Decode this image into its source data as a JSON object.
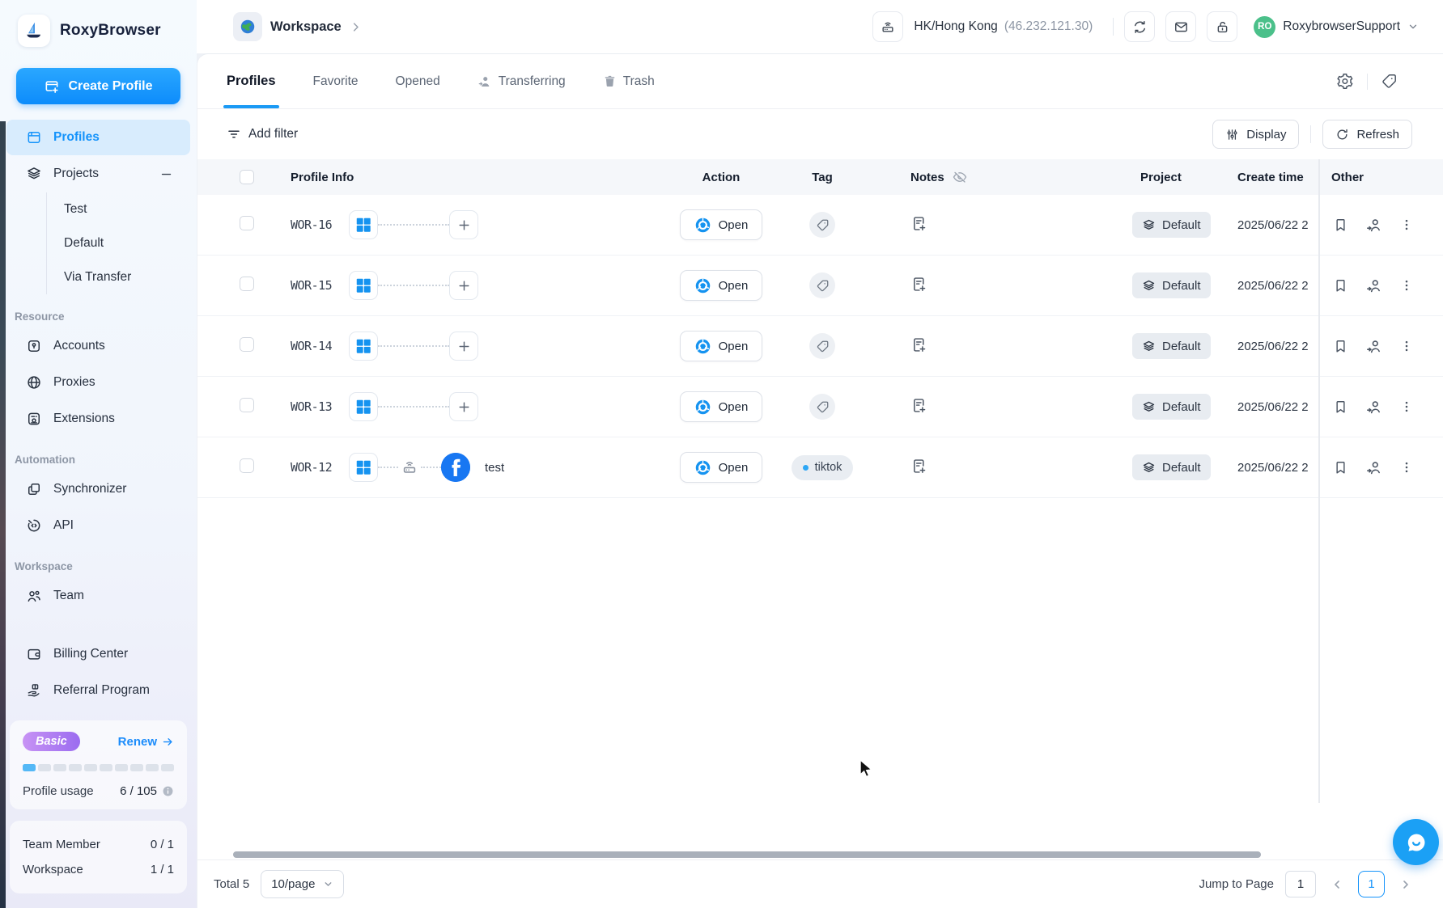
{
  "app": {
    "title": "RoxyBrowser"
  },
  "topbar": {
    "breadcrumb": "Workspace",
    "location": "HK/Hong Kong",
    "ip": "(46.232.121.30)",
    "user": {
      "initials": "RO",
      "name": "RoxybrowserSupport"
    }
  },
  "sidebar": {
    "create_profile": "Create Profile",
    "profiles": "Profiles",
    "projects": {
      "label": "Projects",
      "children": [
        "Test",
        "Default",
        "Via Transfer"
      ]
    },
    "resource": {
      "title": "Resource",
      "accounts": "Accounts",
      "proxies": "Proxies",
      "extensions": "Extensions"
    },
    "automation": {
      "title": "Automation",
      "synchronizer": "Synchronizer",
      "api": "API"
    },
    "workspace": {
      "title": "Workspace",
      "team": "Team"
    },
    "billing": "Billing Center",
    "referral": "Referral Program",
    "plan": {
      "badge": "Basic",
      "renew": "Renew",
      "usage_label": "Profile usage",
      "usage_value": "6 / 105",
      "progress_total": 10,
      "progress_filled": 1
    },
    "limits": [
      {
        "label": "Team Member",
        "value": "0 / 1"
      },
      {
        "label": "Workspace",
        "value": "1 / 1"
      }
    ]
  },
  "tabs": {
    "profiles": "Profiles",
    "favorite": "Favorite",
    "opened": "Opened",
    "transferring": "Transferring",
    "trash": "Trash"
  },
  "toolbar": {
    "add_filter": "Add filter",
    "display": "Display",
    "refresh": "Refresh"
  },
  "table": {
    "columns": {
      "profile_info": "Profile Info",
      "action": "Action",
      "tag": "Tag",
      "notes": "Notes",
      "project": "Project",
      "create_time": "Create time",
      "other": "Other"
    },
    "open_label": "Open",
    "rows": [
      {
        "id": "WOR-16",
        "platform": "windows",
        "has_proxy": false,
        "account": null,
        "name": "",
        "tag": null,
        "project": "Default",
        "create_time": "2025/06/22 2"
      },
      {
        "id": "WOR-15",
        "platform": "windows",
        "has_proxy": false,
        "account": null,
        "name": "",
        "tag": null,
        "project": "Default",
        "create_time": "2025/06/22 2"
      },
      {
        "id": "WOR-14",
        "platform": "windows",
        "has_proxy": false,
        "account": null,
        "name": "",
        "tag": null,
        "project": "Default",
        "create_time": "2025/06/22 2"
      },
      {
        "id": "WOR-13",
        "platform": "windows",
        "has_proxy": false,
        "account": null,
        "name": "",
        "tag": null,
        "project": "Default",
        "create_time": "2025/06/22 2"
      },
      {
        "id": "WOR-12",
        "platform": "windows",
        "has_proxy": true,
        "account": "facebook",
        "name": "test",
        "tag": "tiktok",
        "project": "Default",
        "create_time": "2025/06/22 2"
      }
    ]
  },
  "footer": {
    "total": "Total 5",
    "page_size": "10/page",
    "jump_label": "Jump to Page",
    "jump_value": "1",
    "current_page": "1"
  },
  "colors": {
    "accent": "#1493fb",
    "windows_blue": "#1593f0",
    "facebook_blue": "#1877f2",
    "avatar_green": "#4bc08a",
    "tag_dot_blue": "#2da7f5",
    "plan_badge_start": "#c793f4",
    "plan_badge_end": "#9b6cf0",
    "progress_fill": "#54b8f6",
    "chat_blue": "#1ba0f5"
  }
}
